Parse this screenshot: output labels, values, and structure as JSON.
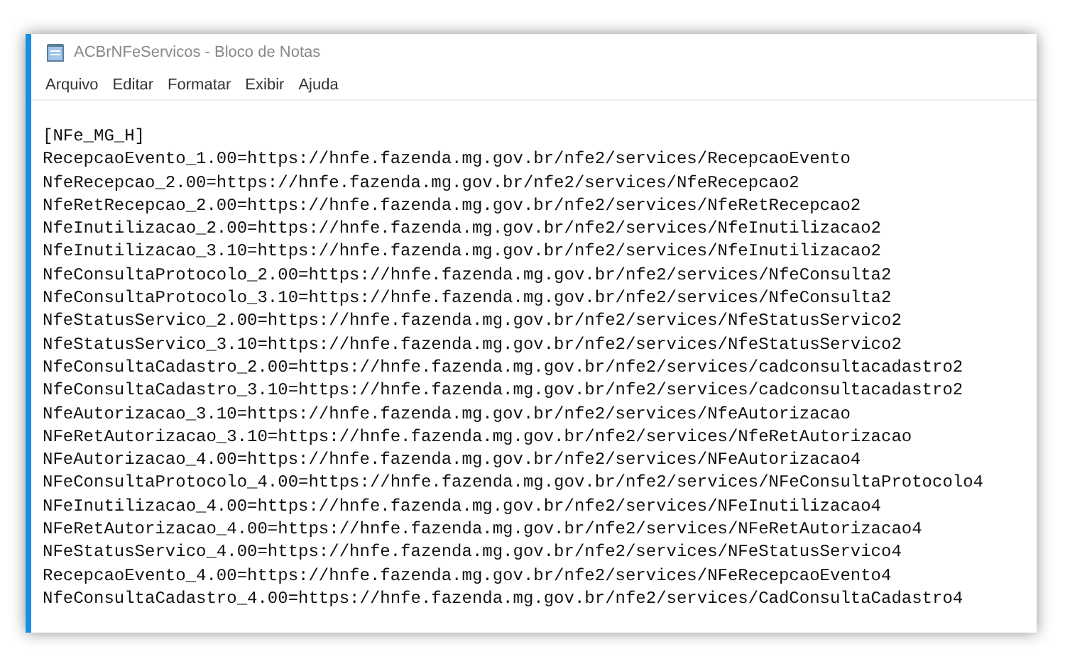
{
  "window": {
    "title": "ACBrNFeServicos - Bloco de Notas"
  },
  "menu": [
    "Arquivo",
    "Editar",
    "Formatar",
    "Exibir",
    "Ajuda"
  ],
  "lines": [
    "[NFe_MG_H]",
    "RecepcaoEvento_1.00=https://hnfe.fazenda.mg.gov.br/nfe2/services/RecepcaoEvento",
    "NfeRecepcao_2.00=https://hnfe.fazenda.mg.gov.br/nfe2/services/NfeRecepcao2",
    "NfeRetRecepcao_2.00=https://hnfe.fazenda.mg.gov.br/nfe2/services/NfeRetRecepcao2",
    "NfeInutilizacao_2.00=https://hnfe.fazenda.mg.gov.br/nfe2/services/NfeInutilizacao2",
    "NfeInutilizacao_3.10=https://hnfe.fazenda.mg.gov.br/nfe2/services/NfeInutilizacao2",
    "NfeConsultaProtocolo_2.00=https://hnfe.fazenda.mg.gov.br/nfe2/services/NfeConsulta2",
    "NfeConsultaProtocolo_3.10=https://hnfe.fazenda.mg.gov.br/nfe2/services/NfeConsulta2",
    "NfeStatusServico_2.00=https://hnfe.fazenda.mg.gov.br/nfe2/services/NfeStatusServico2",
    "NfeStatusServico_3.10=https://hnfe.fazenda.mg.gov.br/nfe2/services/NfeStatusServico2",
    "NfeConsultaCadastro_2.00=https://hnfe.fazenda.mg.gov.br/nfe2/services/cadconsultacadastro2",
    "NfeConsultaCadastro_3.10=https://hnfe.fazenda.mg.gov.br/nfe2/services/cadconsultacadastro2",
    "NfeAutorizacao_3.10=https://hnfe.fazenda.mg.gov.br/nfe2/services/NfeAutorizacao",
    "NFeRetAutorizacao_3.10=https://hnfe.fazenda.mg.gov.br/nfe2/services/NfeRetAutorizacao",
    "NFeAutorizacao_4.00=https://hnfe.fazenda.mg.gov.br/nfe2/services/NFeAutorizacao4",
    "NFeConsultaProtocolo_4.00=https://hnfe.fazenda.mg.gov.br/nfe2/services/NFeConsultaProtocolo4",
    "NFeInutilizacao_4.00=https://hnfe.fazenda.mg.gov.br/nfe2/services/NFeInutilizacao4",
    "NFeRetAutorizacao_4.00=https://hnfe.fazenda.mg.gov.br/nfe2/services/NFeRetAutorizacao4",
    "NFeStatusServico_4.00=https://hnfe.fazenda.mg.gov.br/nfe2/services/NFeStatusServico4",
    "RecepcaoEvento_4.00=https://hnfe.fazenda.mg.gov.br/nfe2/services/NFeRecepcaoEvento4",
    "NfeConsultaCadastro_4.00=https://hnfe.fazenda.mg.gov.br/nfe2/services/CadConsultaCadastro4"
  ]
}
